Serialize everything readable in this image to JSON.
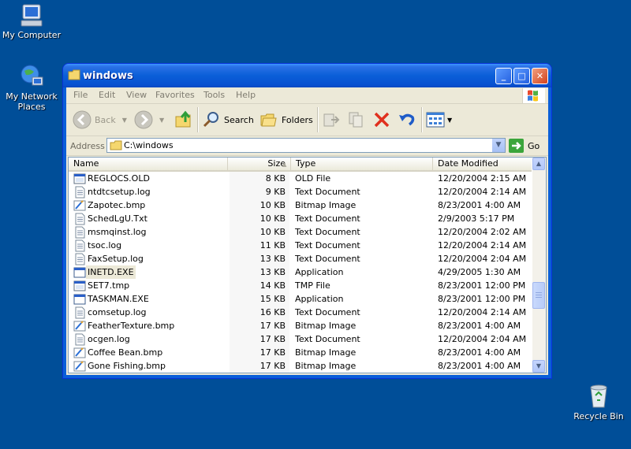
{
  "desktop": {
    "icons": [
      {
        "label": "My Computer",
        "icon": "my-computer-icon"
      },
      {
        "label": "My Network Places",
        "icon": "network-places-icon"
      },
      {
        "label": "Recycle Bin",
        "icon": "recycle-bin-icon"
      }
    ],
    "background_color": "#004E98"
  },
  "window": {
    "title": "windows",
    "menu": [
      "File",
      "Edit",
      "View",
      "Favorites",
      "Tools",
      "Help"
    ],
    "toolbar": {
      "back_label": "Back",
      "search_label": "Search",
      "folders_label": "Folders"
    },
    "address": {
      "label": "Address",
      "value": "C:\\windows",
      "go_label": "Go"
    },
    "columns": [
      "Name",
      "Size",
      "Type",
      "Date Modified"
    ],
    "selected_row": "INETD.EXE",
    "files": [
      {
        "name": "REGLOCS.OLD",
        "size": "8 KB",
        "type": "OLD File",
        "date": "12/20/2004 2:15 AM",
        "icon": "generic-file-icon"
      },
      {
        "name": "ntdtcsetup.log",
        "size": "9 KB",
        "type": "Text Document",
        "date": "12/20/2004 2:14 AM",
        "icon": "text-file-icon"
      },
      {
        "name": "Zapotec.bmp",
        "size": "10 KB",
        "type": "Bitmap Image",
        "date": "8/23/2001 4:00 AM",
        "icon": "bitmap-file-icon"
      },
      {
        "name": "SchedLgU.Txt",
        "size": "10 KB",
        "type": "Text Document",
        "date": "2/9/2003 5:17 PM",
        "icon": "text-file-icon"
      },
      {
        "name": "msmqinst.log",
        "size": "10 KB",
        "type": "Text Document",
        "date": "12/20/2004 2:02 AM",
        "icon": "text-file-icon"
      },
      {
        "name": "tsoc.log",
        "size": "11 KB",
        "type": "Text Document",
        "date": "12/20/2004 2:14 AM",
        "icon": "text-file-icon"
      },
      {
        "name": "FaxSetup.log",
        "size": "13 KB",
        "type": "Text Document",
        "date": "12/20/2004 2:04 AM",
        "icon": "text-file-icon"
      },
      {
        "name": "INETD.EXE",
        "size": "13 KB",
        "type": "Application",
        "date": "4/29/2005 1:30 AM",
        "icon": "application-icon"
      },
      {
        "name": "SET7.tmp",
        "size": "14 KB",
        "type": "TMP File",
        "date": "8/23/2001 12:00 PM",
        "icon": "generic-file-icon"
      },
      {
        "name": "TASKMAN.EXE",
        "size": "15 KB",
        "type": "Application",
        "date": "8/23/2001 12:00 PM",
        "icon": "application-icon"
      },
      {
        "name": "comsetup.log",
        "size": "16 KB",
        "type": "Text Document",
        "date": "12/20/2004 2:14 AM",
        "icon": "text-file-icon"
      },
      {
        "name": "FeatherTexture.bmp",
        "size": "17 KB",
        "type": "Bitmap Image",
        "date": "8/23/2001 4:00 AM",
        "icon": "bitmap-file-icon"
      },
      {
        "name": "ocgen.log",
        "size": "17 KB",
        "type": "Text Document",
        "date": "12/20/2004 2:04 AM",
        "icon": "text-file-icon"
      },
      {
        "name": "Coffee Bean.bmp",
        "size": "17 KB",
        "type": "Bitmap Image",
        "date": "8/23/2001 4:00 AM",
        "icon": "bitmap-file-icon"
      },
      {
        "name": "Gone Fishing.bmp",
        "size": "17 KB",
        "type": "Bitmap Image",
        "date": "8/23/2001 4:00 AM",
        "icon": "bitmap-file-icon"
      }
    ]
  }
}
